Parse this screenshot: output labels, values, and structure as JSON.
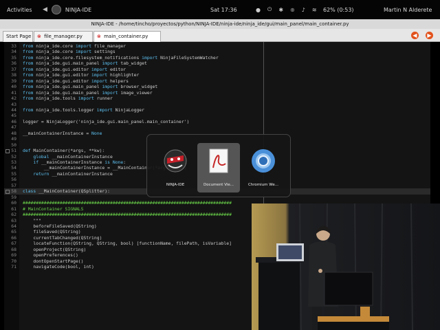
{
  "top_panel": {
    "activities": "Activities",
    "app_name": "NINJA-IDE",
    "clock": "Sat 17:36",
    "battery": "62% (0:53)",
    "user": "Martin N Alderete"
  },
  "window": {
    "title": "NINJA-IDE - /home/tincho/proyectos/python/NINJA-IDE/ninja-ide/ninja_ide/gui/main_panel/main_container.py"
  },
  "tabs": [
    {
      "label": "Start Page"
    },
    {
      "label": "file_manager.py"
    },
    {
      "label": "main_container.py"
    }
  ],
  "editor": {
    "lines": [
      {
        "num": "33",
        "text": "from ninja_ide.core import file_manager"
      },
      {
        "num": "34",
        "text": "from ninja_ide.core import settings"
      },
      {
        "num": "35",
        "text": "from ninja_ide.core.filesystem_notifications import NinjaFileSystemWatcher"
      },
      {
        "num": "36",
        "text": "from ninja_ide.gui.main_panel import tab_widget"
      },
      {
        "num": "37",
        "text": "from ninja_ide.gui.editor import editor"
      },
      {
        "num": "38",
        "text": "from ninja_ide.gui.editor import highlighter"
      },
      {
        "num": "39",
        "text": "from ninja_ide.gui.editor import helpers"
      },
      {
        "num": "40",
        "text": "from ninja_ide.gui.main_panel import browser_widget"
      },
      {
        "num": "41",
        "text": "from ninja_ide.gui.main_panel import image_viewer"
      },
      {
        "num": "42",
        "text": "from ninja_ide.tools import runner"
      },
      {
        "num": "43",
        "text": ""
      },
      {
        "num": "44",
        "text": "from ninja_ide.tools.logger import NinjaLogger"
      },
      {
        "num": "45",
        "text": ""
      },
      {
        "num": "46",
        "text": "logger = NinjaLogger('ninja_ide.gui.main_panel.main_container')"
      },
      {
        "num": "47",
        "text": ""
      },
      {
        "num": "48",
        "text": "__mainContainerInstance = None"
      },
      {
        "num": "49",
        "text": ""
      },
      {
        "num": "50",
        "text": ""
      },
      {
        "num": "51",
        "text": "def MainContainer(*args, **kw):"
      },
      {
        "num": "52",
        "text": "    global __mainContainerInstance"
      },
      {
        "num": "53",
        "text": "    if __mainContainerInstance is None:"
      },
      {
        "num": "54",
        "text": "        __mainContainerInstance = __MainContainer(*args, **kw)"
      },
      {
        "num": "55",
        "text": "    return __mainContainerInstance"
      },
      {
        "num": "56",
        "text": ""
      },
      {
        "num": "57",
        "text": ""
      },
      {
        "num": "58",
        "text": "class __MainContainer(QSplitter):"
      },
      {
        "num": "59",
        "text": ""
      },
      {
        "num": "60",
        "text": "###############################################################################"
      },
      {
        "num": "61",
        "text": "# MainContainer SIGNALS"
      },
      {
        "num": "62",
        "text": "###############################################################################"
      },
      {
        "num": "63",
        "text": "    \"\"\""
      },
      {
        "num": "64",
        "text": "    beforeFileSaved(QString)"
      },
      {
        "num": "65",
        "text": "    fileSaved(QString)"
      },
      {
        "num": "66",
        "text": "    currentTabChanged(QString)"
      },
      {
        "num": "67",
        "text": "    locateFunction(QString, QString, bool) [functionName, filePath, isVariable]"
      },
      {
        "num": "68",
        "text": "    openProject(QString)"
      },
      {
        "num": "69",
        "text": "    openPreferences()"
      },
      {
        "num": "70",
        "text": "    dontOpenStartPage()"
      },
      {
        "num": "71",
        "text": "    navigateCode(bool, int)"
      }
    ]
  },
  "switcher": {
    "items": [
      {
        "label": "NINJA-IDE"
      },
      {
        "label": "Document Vie..."
      },
      {
        "label": "Chromium We..."
      }
    ]
  },
  "colors": {
    "editor_bg": "#141414",
    "keyword": "#5ec2f2",
    "comment": "#6bd64a",
    "accent": "#e2521c"
  }
}
